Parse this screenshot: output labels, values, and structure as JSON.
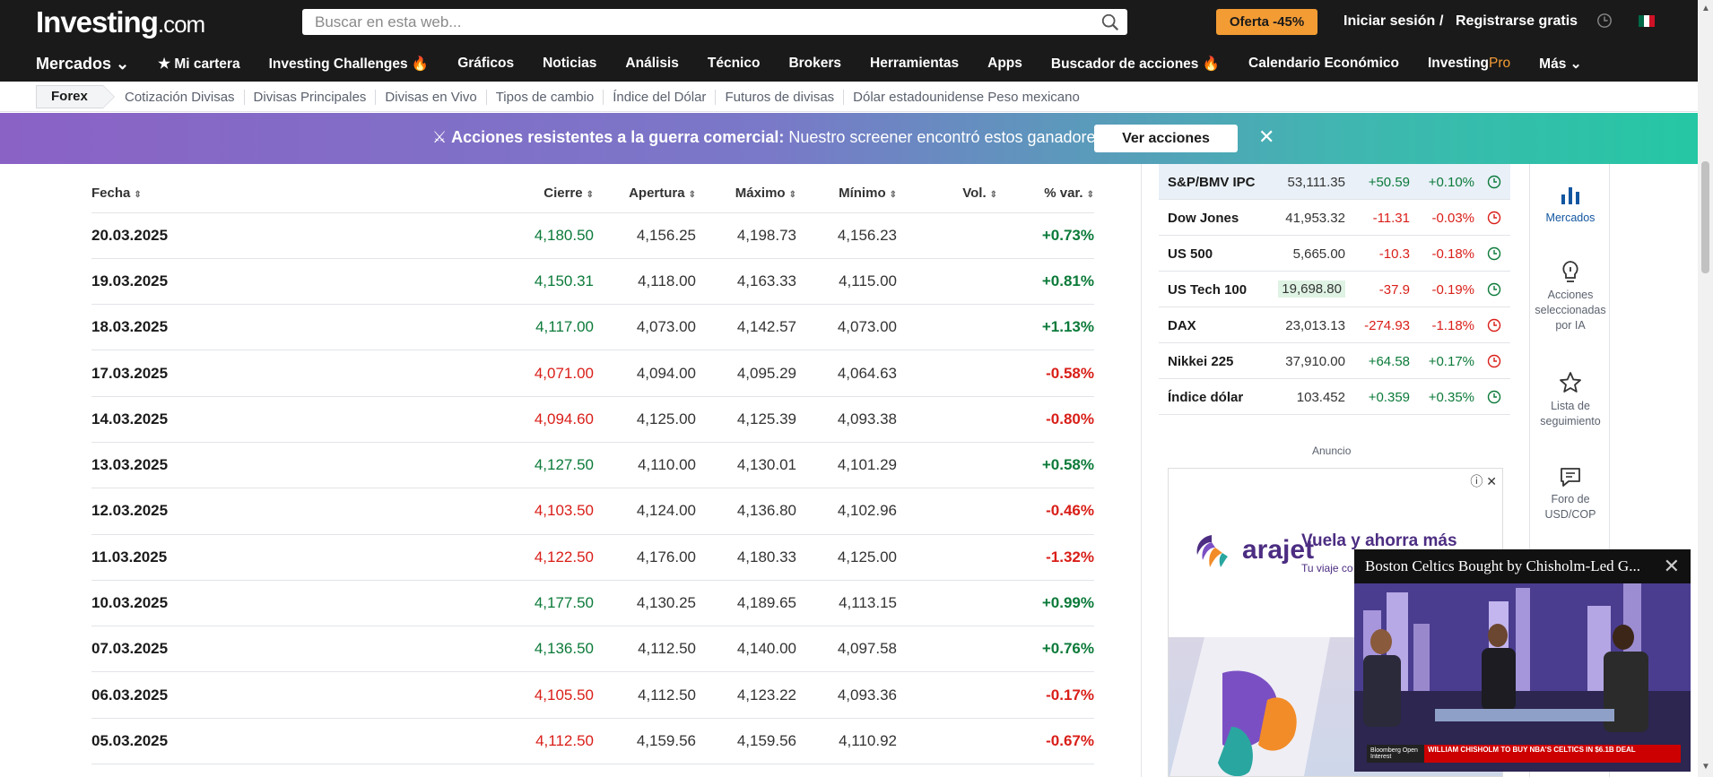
{
  "header": {
    "logo_main": "Investing",
    "logo_suffix": ".com",
    "search_placeholder": "Buscar en esta web...",
    "offer_label": "Oferta -45%",
    "login_label": "Iniciar sesión",
    "separator": "/",
    "register_label": "Registrarse gratis",
    "flag_colors": [
      "#006847",
      "#ffffff",
      "#ce1126"
    ]
  },
  "nav": {
    "items": [
      "Mercados ⌄",
      "★ Mi cartera",
      "Investing Challenges 🔥",
      "Gráficos",
      "Noticias",
      "Análisis",
      "Técnico",
      "Brokers",
      "Herramientas",
      "Apps",
      "Buscador de acciones 🔥",
      "Calendario Económico"
    ],
    "pro_a": "Investing",
    "pro_b": "Pro",
    "more": "Más ⌄"
  },
  "subnav": {
    "active": "Forex",
    "links": [
      "Cotización Divisas",
      "Divisas Principales",
      "Divisas en Vivo",
      "Tipos de cambio",
      "Índice del Dólar",
      "Futuros de divisas",
      "Dólar estadounidense Peso mexicano"
    ]
  },
  "banner": {
    "icon": "⚔",
    "bold": "Acciones resistentes a la guerra comercial:",
    "text": " Nuestro screener encontró estos ganadores",
    "button": "Ver acciones",
    "close": "✕",
    "gradient_start": "#8a62c6",
    "gradient_end": "#25c7a4"
  },
  "table": {
    "headers": [
      "Fecha",
      "Cierre",
      "Apertura",
      "Máximo",
      "Mínimo",
      "Vol.",
      "% var."
    ],
    "rows": [
      {
        "date": "20.03.2025",
        "close": "4,180.50",
        "open": "4,156.25",
        "high": "4,198.73",
        "low": "4,156.23",
        "vol": "",
        "chg": "+0.73%",
        "dir": "up"
      },
      {
        "date": "19.03.2025",
        "close": "4,150.31",
        "open": "4,118.00",
        "high": "4,163.33",
        "low": "4,115.00",
        "vol": "",
        "chg": "+0.81%",
        "dir": "up"
      },
      {
        "date": "18.03.2025",
        "close": "4,117.00",
        "open": "4,073.00",
        "high": "4,142.57",
        "low": "4,073.00",
        "vol": "",
        "chg": "+1.13%",
        "dir": "up"
      },
      {
        "date": "17.03.2025",
        "close": "4,071.00",
        "open": "4,094.00",
        "high": "4,095.29",
        "low": "4,064.63",
        "vol": "",
        "chg": "-0.58%",
        "dir": "down"
      },
      {
        "date": "14.03.2025",
        "close": "4,094.60",
        "open": "4,125.00",
        "high": "4,125.39",
        "low": "4,093.38",
        "vol": "",
        "chg": "-0.80%",
        "dir": "down"
      },
      {
        "date": "13.03.2025",
        "close": "4,127.50",
        "open": "4,110.00",
        "high": "4,130.01",
        "low": "4,101.29",
        "vol": "",
        "chg": "+0.58%",
        "dir": "up"
      },
      {
        "date": "12.03.2025",
        "close": "4,103.50",
        "open": "4,124.00",
        "high": "4,136.80",
        "low": "4,102.96",
        "vol": "",
        "chg": "-0.46%",
        "dir": "down"
      },
      {
        "date": "11.03.2025",
        "close": "4,122.50",
        "open": "4,176.00",
        "high": "4,180.33",
        "low": "4,125.00",
        "vol": "",
        "chg": "-1.32%",
        "dir": "down"
      },
      {
        "date": "10.03.2025",
        "close": "4,177.50",
        "open": "4,130.25",
        "high": "4,189.65",
        "low": "4,113.15",
        "vol": "",
        "chg": "+0.99%",
        "dir": "up"
      },
      {
        "date": "07.03.2025",
        "close": "4,136.50",
        "open": "4,112.50",
        "high": "4,140.00",
        "low": "4,097.58",
        "vol": "",
        "chg": "+0.76%",
        "dir": "up"
      },
      {
        "date": "06.03.2025",
        "close": "4,105.50",
        "open": "4,112.50",
        "high": "4,123.22",
        "low": "4,093.36",
        "vol": "",
        "chg": "-0.17%",
        "dir": "down"
      },
      {
        "date": "05.03.2025",
        "close": "4,112.50",
        "open": "4,159.56",
        "high": "4,159.56",
        "low": "4,110.92",
        "vol": "",
        "chg": "-0.67%",
        "dir": "down"
      }
    ]
  },
  "markets": [
    {
      "name": "S&P/BMV IPC",
      "price": "53,111.35",
      "change": "+50.59",
      "pct": "+0.10%",
      "dir": "up",
      "clock": "open"
    },
    {
      "name": "Dow Jones",
      "price": "41,953.32",
      "change": "-11.31",
      "pct": "-0.03%",
      "dir": "down",
      "clock": "closed"
    },
    {
      "name": "US 500",
      "price": "5,665.00",
      "change": "-10.3",
      "pct": "-0.18%",
      "dir": "down",
      "clock": "open"
    },
    {
      "name": "US Tech 100",
      "price": "19,698.80",
      "change": "-37.9",
      "pct": "-0.19%",
      "dir": "down",
      "clock": "open"
    },
    {
      "name": "DAX",
      "price": "23,013.13",
      "change": "-274.93",
      "pct": "-1.18%",
      "dir": "down",
      "clock": "closed"
    },
    {
      "name": "Nikkei 225",
      "price": "37,910.00",
      "change": "+64.58",
      "pct": "+0.17%",
      "dir": "up",
      "clock": "closed"
    },
    {
      "name": "Índice dólar",
      "price": "103.452",
      "change": "+0.359",
      "pct": "+0.35%",
      "dir": "up",
      "clock": "open"
    }
  ],
  "ad": {
    "label": "Anuncio",
    "brand": "arajet",
    "headline": "Vuela y ahorra más",
    "sub": "Tu viaje co",
    "brand_color": "#4c2d82"
  },
  "rail": [
    {
      "label": "Mercados",
      "icon": "bar-chart-icon"
    },
    {
      "label": "Acciones seleccionadas por IA",
      "icon": "lightbulb-icon"
    },
    {
      "label": "Lista de seguimiento",
      "icon": "star-icon"
    },
    {
      "label": "Foro de USD/COP",
      "icon": "chat-icon"
    }
  ],
  "video": {
    "title": "Boston Celtics Bought by Chisholm-Led G...",
    "close": "✕",
    "tag": "Bloomberg Open Interest",
    "ticker": "WILLIAM CHISHOLM TO BUY NBA'S CELTICS IN $6.1B DEAL"
  },
  "colors": {
    "up": "#0b7a39",
    "down": "#d91e18",
    "accent": "#f39c34",
    "topbar": "#1a1a1a"
  }
}
